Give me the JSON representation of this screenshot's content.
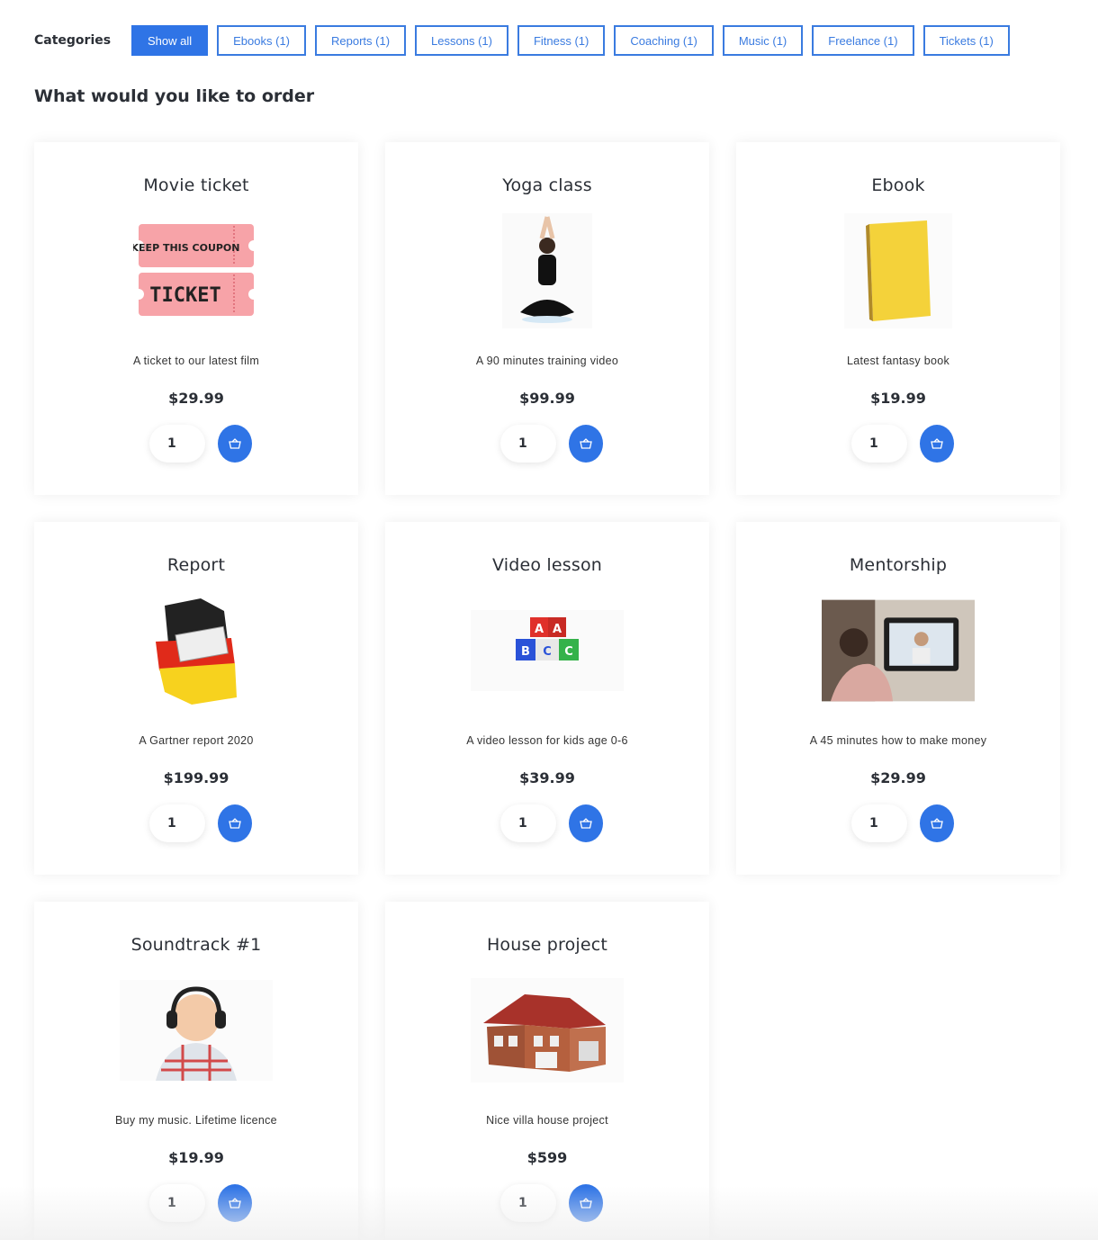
{
  "categories": {
    "label": "Categories",
    "buttons": [
      {
        "label": "Show all",
        "active": true
      },
      {
        "label": "Ebooks (1)"
      },
      {
        "label": "Reports (1)"
      },
      {
        "label": "Lessons (1)"
      },
      {
        "label": "Fitness (1)"
      },
      {
        "label": "Coaching (1)"
      },
      {
        "label": "Music (1)"
      },
      {
        "label": "Freelance (1)"
      },
      {
        "label": "Tickets (1)"
      }
    ]
  },
  "heading": "What would you like to order",
  "accent_color": "#2f74e6",
  "products": [
    {
      "title": "Movie ticket",
      "image": "ticket-coupon-image",
      "desc": "A ticket to our latest film",
      "price": "$29.99",
      "qty": "1"
    },
    {
      "title": "Yoga class",
      "image": "yoga-woman-image",
      "desc": "A 90 minutes training video",
      "price": "$99.99",
      "qty": "1"
    },
    {
      "title": "Ebook",
      "image": "yellow-book-image",
      "desc": "Latest fantasy book",
      "price": "$19.99",
      "qty": "1"
    },
    {
      "title": "Report",
      "image": "germany-map-newspaper-image",
      "desc": "A Gartner report 2020",
      "price": "$199.99",
      "qty": "1"
    },
    {
      "title": "Video lesson",
      "image": "abc-blocks-image",
      "desc": "A video lesson for kids age 0-6",
      "price": "$39.99",
      "qty": "1"
    },
    {
      "title": "Mentorship",
      "image": "video-call-laptop-image",
      "desc": "A 45 minutes how to make money",
      "price": "$29.99",
      "qty": "1"
    },
    {
      "title": "Soundtrack #1",
      "image": "boy-headphones-image",
      "desc": "Buy my music. Lifetime licence",
      "price": "$19.99",
      "qty": "1"
    },
    {
      "title": "House project",
      "image": "brick-house-image",
      "desc": "Nice villa house project",
      "price": "$599",
      "qty": "1"
    }
  ],
  "ticket_image_text": {
    "top": "KEEP THIS COUPON",
    "bottom": "TICKET"
  },
  "blocks_letters": [
    "A",
    "A",
    "B",
    "C",
    "C"
  ]
}
